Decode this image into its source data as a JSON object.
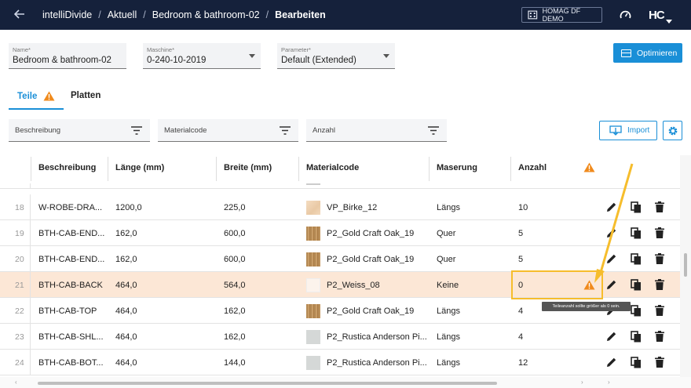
{
  "breadcrumb": {
    "app": "intelliDivide",
    "items": [
      "Aktuell",
      "Bedroom & bathroom-02",
      "Bearbeiten"
    ]
  },
  "tenant": "HOMAG DF DEMO",
  "brand": "HC",
  "form": {
    "name": {
      "label": "Name*",
      "value": "Bedroom & bathroom-02"
    },
    "machine": {
      "label": "Maschine*",
      "value": "0-240-10-2019"
    },
    "parameter": {
      "label": "Parameter*",
      "value": "Default (Extended)"
    }
  },
  "optimize_label": "Optimieren",
  "tabs": [
    {
      "label": "Teile",
      "warning": true
    },
    {
      "label": "Platten"
    }
  ],
  "filters": {
    "description": "Beschreibung",
    "material": "Materialcode",
    "count": "Anzahl"
  },
  "import_label": "Import",
  "columns": [
    "Beschreibung",
    "Länge (mm)",
    "Breite (mm)",
    "Materialcode",
    "Maserung",
    "Anzahl"
  ],
  "rows": [
    {
      "num": "18",
      "desc": "W-ROBE-DRA...",
      "length": "1200,0",
      "width": "225,0",
      "material": "VP_Birke_12",
      "grain": "Längs",
      "count": "10",
      "swatch": "birch"
    },
    {
      "num": "19",
      "desc": "BTH-CAB-END...",
      "length": "162,0",
      "width": "600,0",
      "material": "P2_Gold Craft Oak_19",
      "grain": "Quer",
      "count": "5",
      "swatch": "oak"
    },
    {
      "num": "20",
      "desc": "BTH-CAB-END...",
      "length": "162,0",
      "width": "600,0",
      "material": "P2_Gold Craft Oak_19",
      "grain": "Quer",
      "count": "5",
      "swatch": "oak"
    },
    {
      "num": "21",
      "desc": "BTH-CAB-BACK",
      "length": "464,0",
      "width": "564,0",
      "material": "P2_Weiss_08",
      "grain": "Keine",
      "count": "0",
      "swatch": "white",
      "selected": true
    },
    {
      "num": "22",
      "desc": "BTH-CAB-TOP",
      "length": "464,0",
      "width": "162,0",
      "material": "P2_Gold Craft Oak_19",
      "grain": "Längs",
      "count": "4",
      "swatch": "oak"
    },
    {
      "num": "23",
      "desc": "BTH-CAB-SHL...",
      "length": "464,0",
      "width": "162,0",
      "material": "P2_Rustica Anderson Pi...",
      "grain": "Längs",
      "count": "4",
      "swatch": "grey"
    },
    {
      "num": "24",
      "desc": "BTH-CAB-BOT...",
      "length": "464,0",
      "width": "144,0",
      "material": "P2_Rustica Anderson Pi...",
      "grain": "Längs",
      "count": "12",
      "swatch": "grey"
    }
  ],
  "tooltip": "Teileanzahl sollte größer als 0 sein.",
  "colors": {
    "topbar": "#15213b",
    "accent": "#1a8fd7",
    "warning": "#f08a1c",
    "highlight": "#f6bd2c",
    "selected_row": "#fce7d6"
  }
}
